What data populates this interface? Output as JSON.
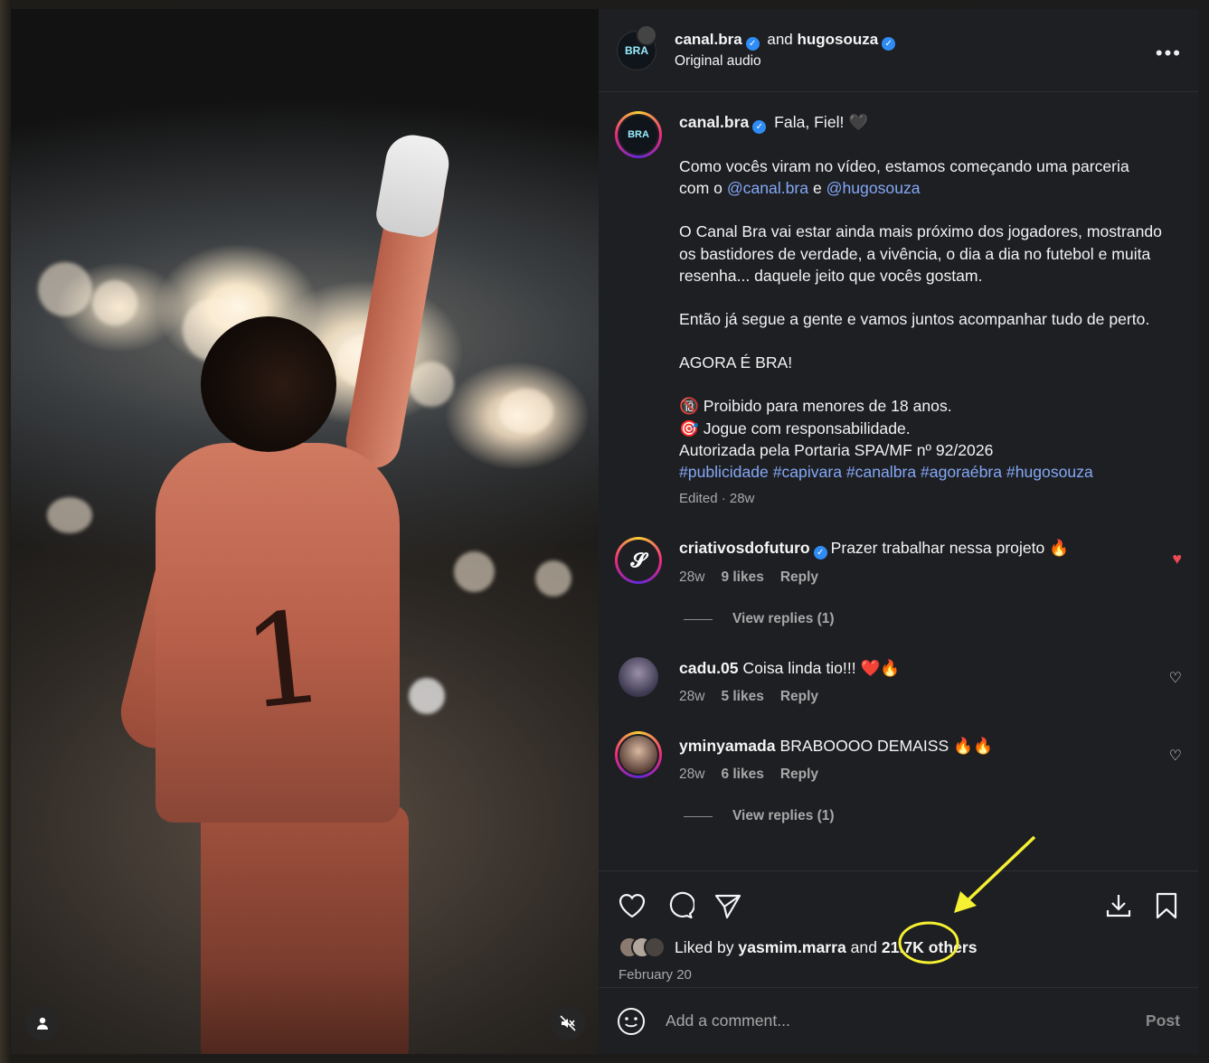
{
  "header": {
    "author1": "canal.bra",
    "joiner": "and",
    "author2": "hugosouza",
    "audio": "Original audio",
    "more_icon": "ellipsis-icon",
    "avatar_text": "BRA"
  },
  "caption": {
    "author": "canal.bra",
    "avatar_text": "BRA",
    "lead": "Fala, Fiel! 🖤",
    "p1_a": "Como vocês viram no vídeo, estamos começando uma parceria com o ",
    "mention1": "@canal.bra",
    "p1_mid": " e ",
    "mention2": "@hugosouza",
    "p2": "O Canal Bra vai estar ainda mais próximo dos jogadores, mostrando os bastidores de verdade, a vivência, o dia a dia no futebol e muita resenha... daquele jeito que vocês gostam.",
    "p3": "Então já segue a gente e vamos juntos acompanhar tudo de perto.",
    "p4": "AGORA É BRA!",
    "l1": "🔞 Proibido para menores de 18 anos.",
    "l2": "🎯 Jogue com responsabilidade.",
    "l3": "Autorizada pela Portaria SPA/MF nº 92/2026",
    "hashtags": "#publicidade #capivara #canalbra #agoraébra #hugosouza",
    "meta": "Edited · 28w"
  },
  "comments": [
    {
      "user": "criativosdofuturo",
      "verified": true,
      "text": "Prazer trabalhar nessa projeto 🔥",
      "age": "28w",
      "likes": "9 likes",
      "reply": "Reply",
      "liked": true,
      "view_replies": "View replies (1)"
    },
    {
      "user": "cadu.05",
      "verified": false,
      "text": "Coisa linda tio!!! ❤️🔥",
      "age": "28w",
      "likes": "5 likes",
      "reply": "Reply",
      "liked": false,
      "view_replies": ""
    },
    {
      "user": "yminyamada",
      "verified": false,
      "text": "BRABOOOO DEMAISS 🔥🔥",
      "age": "28w",
      "likes": "6 likes",
      "reply": "Reply",
      "liked": false,
      "view_replies": "View replies (1)"
    }
  ],
  "actions": {
    "like_icon": "heart-icon",
    "comment_icon": "comment-icon",
    "share_icon": "send-icon",
    "download_icon": "download-icon",
    "save_icon": "bookmark-icon"
  },
  "likes": {
    "prefix": "Liked by",
    "user": "yasmim.marra",
    "and": "and",
    "count": "21.7K",
    "suffix": "others",
    "date": "February 20"
  },
  "composer": {
    "emoji_icon": "smiley-icon",
    "placeholder": "Add a comment...",
    "post": "Post"
  },
  "media": {
    "user_icon": "person-icon",
    "mute_icon": "muted-speaker-icon",
    "jersey_number": "1"
  },
  "colors": {
    "panel": "#1e1f23",
    "link": "#84a8f6",
    "verified": "#2f8cf5",
    "like_red": "#ed4956",
    "annotation": "#f5f032"
  }
}
